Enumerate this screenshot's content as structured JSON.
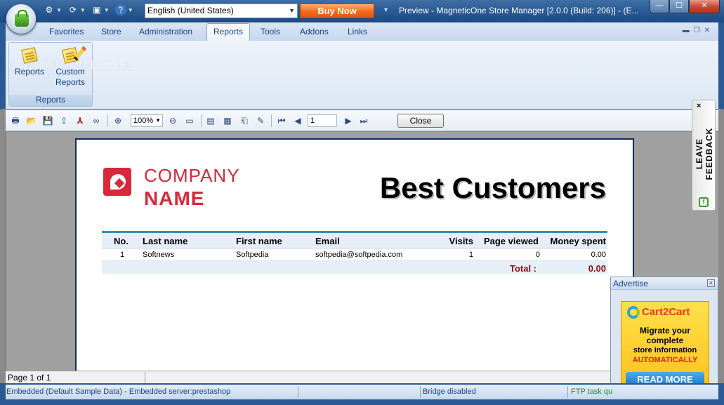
{
  "window": {
    "title": "Preview - MagneticOne Store Manager [2.0.0 (Build: 206)] - (E...",
    "language": "English (United States)",
    "buy_now": "Buy Now",
    "buttons": {
      "min": "—",
      "max": "☐",
      "close": "✕"
    }
  },
  "ribbon": {
    "tabs": [
      "Favorites",
      "Store",
      "Administration",
      "Reports",
      "Tools",
      "Addons",
      "Links"
    ],
    "active_tab": "Reports",
    "group": {
      "label": "Reports",
      "buttons": [
        {
          "label1": "Reports",
          "label2": ""
        },
        {
          "label1": "Custom",
          "label2": "Reports"
        }
      ]
    },
    "watermark": "SOFTPEDIA"
  },
  "toolbar": {
    "zoom": "100%",
    "page": "1",
    "close": "Close"
  },
  "report": {
    "company_line1": "COMPANY",
    "company_line2": "NAME",
    "title": "Best Customers",
    "columns": [
      "No.",
      "Last name",
      "First name",
      "Email",
      "Visits",
      "Page viewed",
      "Money spent"
    ],
    "rows": [
      {
        "no": "1",
        "last": "Softnews",
        "first": "Softpedia",
        "email": "softpedia@softpedia.com",
        "visits": "1",
        "pages": "0",
        "money": "0.00"
      }
    ],
    "total_label": "Total :",
    "total_value": "0.00"
  },
  "feedback": {
    "text": "LEAVE FEEDBACK",
    "close": "×"
  },
  "ad": {
    "header": "Advertise",
    "brand": "Cart2Cart",
    "line1": "Migrate your",
    "line2": "complete",
    "line3": "store information",
    "line4": "AUTOMATICALLY",
    "button": "READ MORE"
  },
  "page_status": "Page 1 of 1",
  "status": {
    "connection": "Embedded (Default Sample Data) - Embedded server:prestashop",
    "bridge": "Bridge disabled",
    "ftp": "FTP task qu"
  }
}
